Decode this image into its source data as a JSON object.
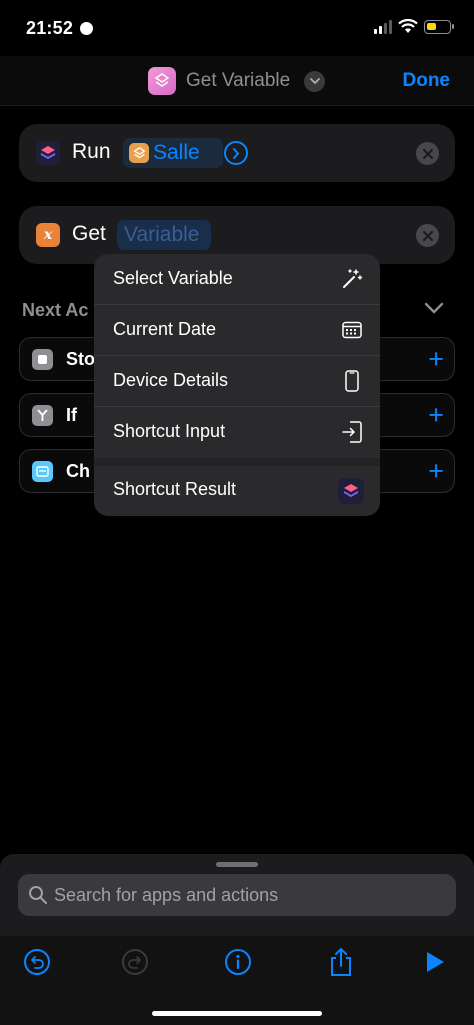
{
  "status_bar": {
    "time": "21:52"
  },
  "header": {
    "title": "Get Variable",
    "done_label": "Done"
  },
  "run_action": {
    "verb": "Run",
    "shortcut_name": "Salle"
  },
  "get_action": {
    "verb": "Get",
    "placeholder_token": "Variable"
  },
  "next_actions": {
    "label": "Next Ac",
    "items": [
      {
        "label": "Sto",
        "icon": "stop-icon"
      },
      {
        "label": "If",
        "icon": "branch-icon"
      },
      {
        "label": "Ch",
        "icon": "choose-menu-icon"
      }
    ]
  },
  "variable_menu": {
    "items": [
      {
        "label": "Select Variable",
        "icon": "magic-wand-icon"
      },
      {
        "label": "Current Date",
        "icon": "calendar-icon"
      },
      {
        "label": "Device Details",
        "icon": "phone-icon"
      },
      {
        "label": "Shortcut Input",
        "icon": "input-arrow-icon"
      },
      {
        "label": "Shortcut Result",
        "icon": "shortcuts-app-icon"
      }
    ]
  },
  "search": {
    "placeholder": "Search for apps and actions"
  },
  "toolbar": {
    "items": [
      "undo-icon",
      "redo-icon",
      "info-icon",
      "share-icon",
      "play-icon"
    ]
  },
  "colors": {
    "accent": "#0a84ff",
    "background": "#000000",
    "card": "#1c1c1e",
    "menu": "#2a2a2c"
  }
}
